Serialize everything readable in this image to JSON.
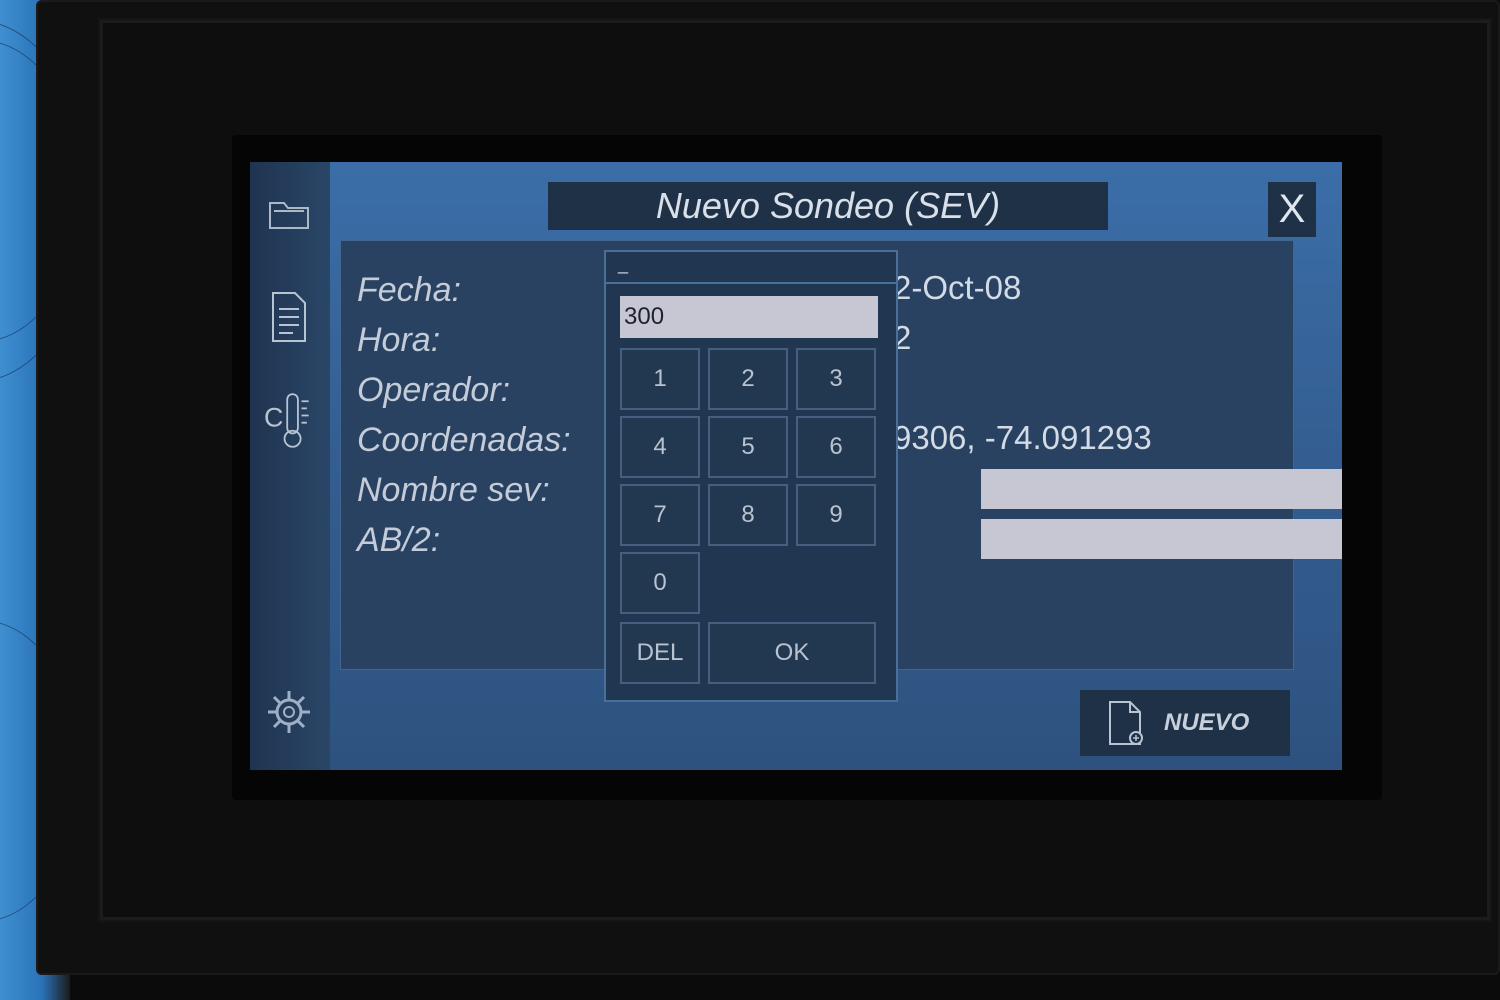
{
  "dialog": {
    "title": "Nuevo Sondeo (SEV)",
    "close_label": "X"
  },
  "form": {
    "fecha_label": "Fecha:",
    "fecha_value": "2-Oct-08",
    "hora_label": "Hora:",
    "hora_value": "2",
    "operador_label": "Operador:",
    "operador_value": "",
    "coordenadas_label": "Coordenadas:",
    "coordenadas_value": "9306, -74.091293",
    "nombre_label": "Nombre sev:",
    "nombre_value": "",
    "ab2_label": "AB/2:",
    "ab2_value": ""
  },
  "keypad": {
    "header_text": "_",
    "display_value": "300",
    "keys": [
      "1",
      "2",
      "3",
      "4",
      "5",
      "6",
      "7",
      "8",
      "9",
      "0"
    ],
    "del_label": "DEL",
    "ok_label": "OK"
  },
  "sidebar": {
    "icons": [
      "folder-icon",
      "document-icon",
      "thermometer-icon",
      "settings-icon"
    ]
  },
  "actions": {
    "nuevo_label": "NUEVO"
  },
  "colors": {
    "screen_bg": "#345f93",
    "panel_bg": "#2a4262",
    "field_bg": "#c7c6d3",
    "title_bg": "#1e3146"
  }
}
